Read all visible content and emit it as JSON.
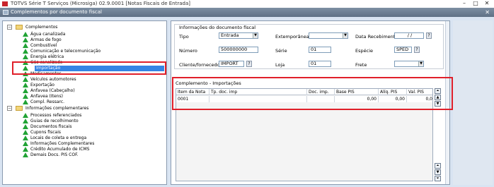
{
  "window": {
    "title": "TOTVS Série T Serviços (Microsiga) 02.9.0001 [Notas Fiscais de Entrada]",
    "minimize": "–",
    "maximize": "□",
    "close": "✕"
  },
  "dialog": {
    "title": "Complementos por documento fiscal",
    "close": "✕"
  },
  "tree": {
    "group1": {
      "label": "Complementos",
      "expander": "−",
      "items": [
        "Água canalizada",
        "Armas de fogo",
        "Combustível",
        "Comunicação e telecomunicação",
        "Energia elétrica",
        "Gás canalizado",
        "Importação",
        "Medicamentos",
        "Veículos automotores",
        "Exportação",
        "Anfavea (Cabeçalho)",
        "Anfavea (Itens)",
        "Compl. Ressarc."
      ],
      "selected": "Importação"
    },
    "group2": {
      "label": "Informações complementares",
      "expander": "−",
      "items": [
        "Processos referenciados",
        "Guias de recolhimento",
        "Documentos fiscais",
        "Cupons fiscais",
        "Locais de coleta e entrega",
        "Informações Complementares",
        "Crédito Acumulado de ICMS",
        "Demais Docs. PIS COF."
      ]
    }
  },
  "info": {
    "legend": "Informações do documento fiscal",
    "tipo_label": "Tipo",
    "tipo_value": "Entrada",
    "extemporanea_label": "Extemporânea",
    "extemporanea_value": "",
    "data_label": "Data Recebimento",
    "data_value": " /  / ",
    "numero_label": "Número",
    "numero_value": "500000000",
    "serie_label": "Série",
    "serie_value": "01",
    "especie_label": "Espécie",
    "especie_value": "SPED",
    "cliente_label": "Cliente/fornecedor",
    "cliente_value": "IMPORT",
    "loja_label": "Loja",
    "loja_value": "01",
    "frete_label": "Frete",
    "frete_value": "",
    "lookup": "?",
    "dropdown": "▼"
  },
  "grid": {
    "title": "Complemento - Importações",
    "columns": [
      "Item da Nota",
      "Tp. doc. imp",
      "Doc. imp.",
      "Base PIS",
      "Alíq. PIS",
      "Val. PIS"
    ],
    "rows": [
      [
        "0001",
        "",
        "",
        "0,00",
        "0,00",
        "0,0"
      ]
    ],
    "scroll": {
      "top": "⏶",
      "up": "▲",
      "down": "▼",
      "bottom": "⏷"
    }
  }
}
